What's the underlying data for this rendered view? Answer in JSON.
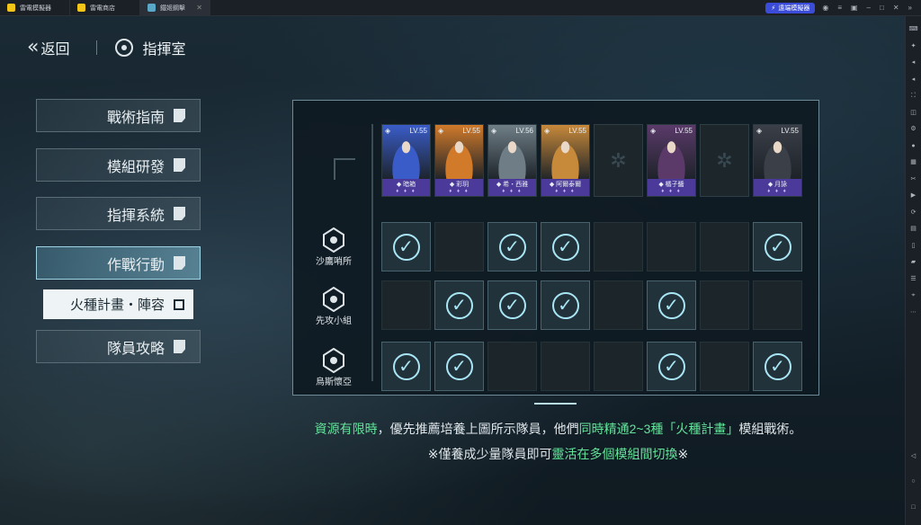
{
  "titlebar": {
    "tabs": [
      {
        "label": "雷電模擬器",
        "color": "#f5c518"
      },
      {
        "label": "雷電商店",
        "color": "#f5c518"
      },
      {
        "label": "鐵姬鋼擊",
        "color": "#5aa8c8"
      }
    ],
    "sync_label": "遠端模擬器"
  },
  "header": {
    "back_label": "返回",
    "section_title": "指揮室"
  },
  "menu": {
    "items": [
      {
        "label": "戰術指南"
      },
      {
        "label": "模組研發"
      },
      {
        "label": "指揮系統"
      },
      {
        "label": "作戰行動"
      },
      {
        "label": "隊員攻略"
      }
    ],
    "submenu_label": "火種計畫・陣容"
  },
  "characters": [
    {
      "name": "暗箱",
      "level": "LV.55",
      "bg": "#3a5cc8",
      "frame": "#4b3a9a"
    },
    {
      "name": "彩玥",
      "level": "LV.55",
      "bg": "#d07a2a",
      "frame": "#4b3a9a"
    },
    {
      "name": "希・西雅",
      "level": "LV.56",
      "bg": "#6f7e86",
      "frame": "#4b3a9a"
    },
    {
      "name": "阿爾泰爾",
      "level": "LV.55",
      "bg": "#c7893a",
      "frame": "#4b3a9a"
    },
    {
      "name": "",
      "level": "",
      "bg": "",
      "frame": ""
    },
    {
      "name": "橘子醬",
      "level": "LV.55",
      "bg": "#5b3a6a",
      "frame": "#4b3a9a"
    },
    {
      "name": "",
      "level": "",
      "bg": "",
      "frame": ""
    },
    {
      "name": "月詠",
      "level": "LV.55",
      "bg": "#3b3f48",
      "frame": "#4b3a9a"
    }
  ],
  "rows": [
    {
      "label": "沙鷹哨所",
      "checks": [
        1,
        0,
        1,
        1,
        0,
        0,
        0,
        1
      ]
    },
    {
      "label": "先攻小組",
      "checks": [
        0,
        1,
        1,
        1,
        0,
        1,
        0,
        0
      ]
    },
    {
      "label": "烏斯懷亞",
      "checks": [
        1,
        1,
        0,
        0,
        0,
        1,
        0,
        1
      ]
    }
  ],
  "notes": {
    "line1_a": "資源有限時",
    "line1_b": "，優先推薦培養上圖所示隊員，他們",
    "line1_c": "同時精通2~3種「火種計畫」",
    "line1_d": "模組戰術。",
    "line2_a": "※僅養成少量隊員即可",
    "line2_b": "靈活在多個模組間切換",
    "line2_c": "※"
  },
  "colors": {
    "highlight": "#63e39a",
    "check": "#a9e6f5"
  }
}
